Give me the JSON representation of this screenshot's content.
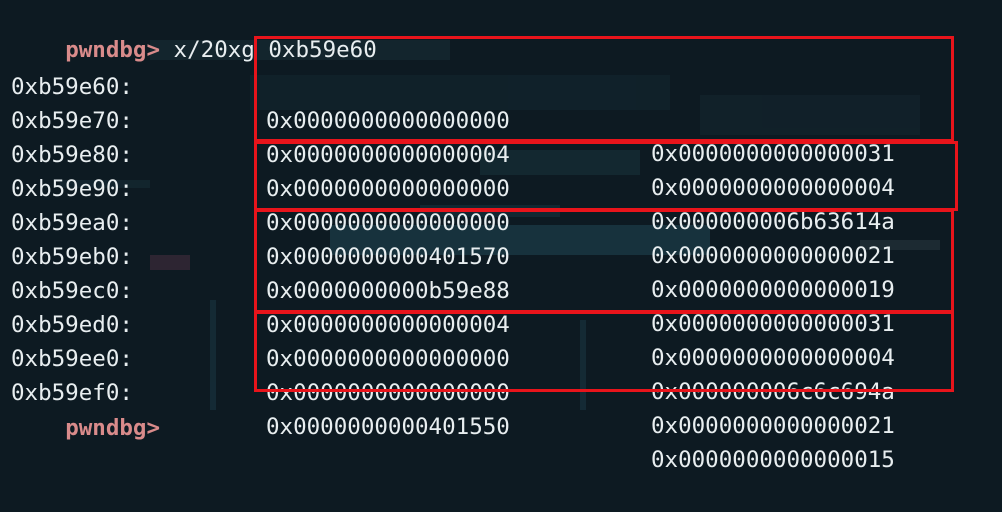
{
  "terminal": {
    "prompt": "pwndbg>",
    "command": " x/20xg 0xb59e60",
    "rows": [
      {
        "addr": "0xb59e60:",
        "q1": "0x0000000000000000",
        "q2": "0x0000000000000031"
      },
      {
        "addr": "0xb59e70:",
        "q1": "0x0000000000000004",
        "q2": "0x0000000000000004"
      },
      {
        "addr": "0xb59e80:",
        "q1": "0x0000000000000000",
        "q2": "0x000000006b63614a"
      },
      {
        "addr": "0xb59e90:",
        "q1": "0x0000000000000000",
        "q2": "0x0000000000000021"
      },
      {
        "addr": "0xb59ea0:",
        "q1": "0x0000000000401570",
        "q2": "0x0000000000000019"
      },
      {
        "addr": "0xb59eb0:",
        "q1": "0x0000000000b59e88",
        "q2": "0x0000000000000031"
      },
      {
        "addr": "0xb59ec0:",
        "q1": "0x0000000000000004",
        "q2": "0x0000000000000004"
      },
      {
        "addr": "0xb59ed0:",
        "q1": "0x0000000000000000",
        "q2": "0x000000006c6c694a"
      },
      {
        "addr": "0xb59ee0:",
        "q1": "0x0000000000000000",
        "q2": "0x0000000000000021"
      },
      {
        "addr": "0xb59ef0:",
        "q1": "0x0000000000401550",
        "q2": "0x0000000000000015"
      }
    ],
    "final_prompt": "pwndbg>"
  },
  "colors": {
    "background": "#0d1a22",
    "prompt": "#d98b8b",
    "text": "#e8eef0",
    "highlight_box": "#e8141b"
  }
}
